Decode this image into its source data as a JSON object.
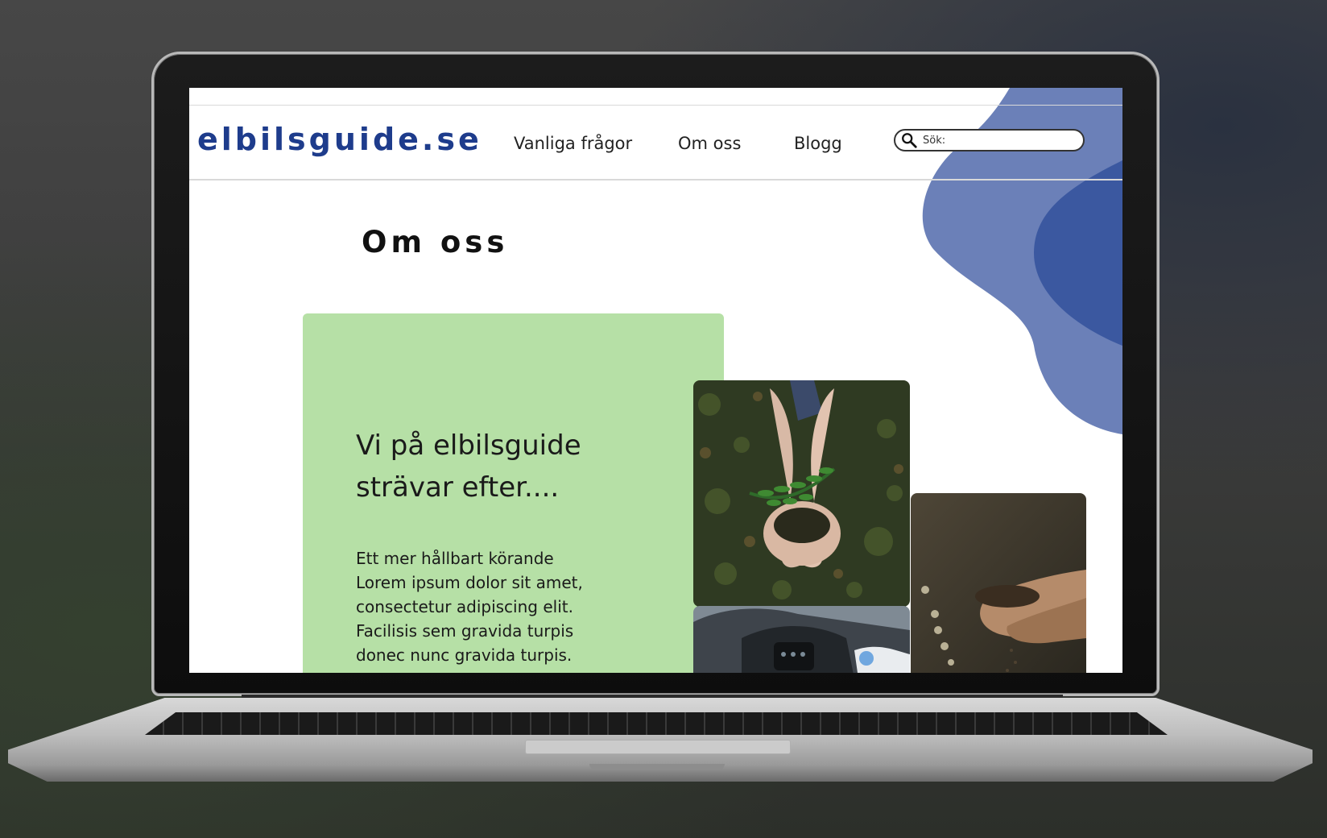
{
  "site": {
    "logo": "elbilsguide.se",
    "nav": [
      {
        "label": "Vanliga frågor"
      },
      {
        "label": "Om oss"
      },
      {
        "label": "Blogg"
      }
    ],
    "search": {
      "placeholder": "Sök:",
      "icon": "search-icon"
    }
  },
  "page": {
    "title": "Om oss",
    "card": {
      "heading": "Vi på elbilsguide strävar efter....",
      "lines": [
        "Ett mer hållbart körande",
        "Lorem ipsum dolor sit amet,",
        "consectetur adipiscing elit.",
        "Facilisis sem gravida turpis",
        "donec nunc gravida turpis."
      ]
    }
  },
  "colors": {
    "brand": "#1e3c8c",
    "card": "#b6e0a6",
    "blob": "#6b80b8",
    "blob_dark": "#3b58a0"
  }
}
